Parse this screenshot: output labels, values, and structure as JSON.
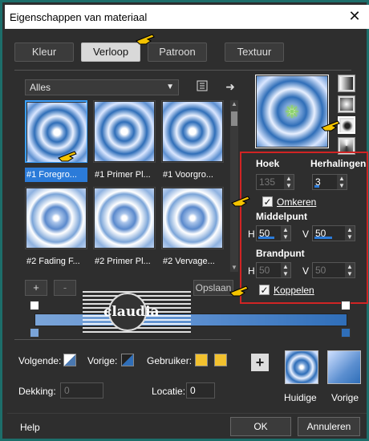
{
  "window": {
    "title": "Eigenschappen van materiaal",
    "close_glyph": "✕"
  },
  "tabs": [
    {
      "label": "Kleur"
    },
    {
      "label": "Verloop"
    },
    {
      "label": "Patroon"
    },
    {
      "label": "Textuur"
    }
  ],
  "gallery": {
    "category": "Alles",
    "items": [
      {
        "label": "#1 Foregro..."
      },
      {
        "label": "#1 Primer Pl..."
      },
      {
        "label": "#1 Voorgro..."
      },
      {
        "label": "#2 Fading F..."
      },
      {
        "label": "#2 Primer Pl..."
      },
      {
        "label": "#2 Vervage..."
      }
    ]
  },
  "editor": {
    "add": "+",
    "remove": "-",
    "save": "Opslaan"
  },
  "settings": {
    "hoek_label": "Hoek",
    "hoek_value": "135",
    "herhalingen_label": "Herhalingen",
    "herhalingen_value": "3",
    "omkeren_label": "Omkeren",
    "middelpunt_label": "Middelpunt",
    "h_label": "H",
    "v_label": "V",
    "middelpunt_h": "50",
    "middelpunt_v": "50",
    "brandpunt_label": "Brandpunt",
    "brandpunt_h": "50",
    "brandpunt_v": "50",
    "koppelen_label": "Koppelen",
    "check": "✓"
  },
  "stops": {
    "volgende_label": "Volgende:",
    "vorige_label": "Vorige:",
    "gebruiker_label": "Gebruiker:",
    "dekking_label": "Dekking:",
    "dekking_value": "0",
    "locatie_label": "Locatie:",
    "locatie_value": "0"
  },
  "logo": {
    "text": "claudia"
  },
  "previews": {
    "current_label": "Huidige",
    "previous_label": "Vorige"
  },
  "footer": {
    "help": "Help",
    "ok": "OK",
    "cancel": "Annuleren"
  },
  "colors": {
    "accent": "#2b7bd9",
    "highlight": "#d02424",
    "user_swatch": "#f2c12e"
  }
}
